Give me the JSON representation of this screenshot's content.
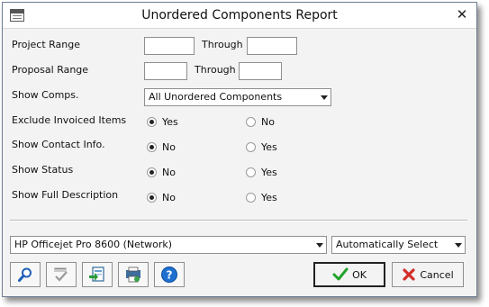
{
  "window": {
    "title": "Unordered Components Report",
    "close_glyph": "✕"
  },
  "form": {
    "project_range": {
      "label": "Project Range",
      "from": "",
      "through_label": "Through",
      "to": ""
    },
    "proposal_range": {
      "label": "Proposal Range",
      "from": "",
      "through_label": "Through",
      "to": ""
    },
    "show_comps": {
      "label": "Show Comps.",
      "selected": "All Unordered Components"
    },
    "exclude_invoiced": {
      "label": "Exclude Invoiced Items",
      "option1": "Yes",
      "option2": "No",
      "selected": "Yes"
    },
    "show_contact": {
      "label": "Show Contact Info.",
      "option1": "No",
      "option2": "Yes",
      "selected": "No"
    },
    "show_status": {
      "label": "Show Status",
      "option1": "No",
      "option2": "Yes",
      "selected": "No"
    },
    "show_full_description": {
      "label": "Show Full Description",
      "option1": "No",
      "option2": "Yes",
      "selected": "No"
    }
  },
  "printer": {
    "selected": "HP Officejet Pro 8600 (Network)",
    "tray": "Automatically Select"
  },
  "toolbar": {
    "icons": [
      "magnifier-icon",
      "spellcheck-icon",
      "export-icon",
      "print-setup-icon",
      "help-icon"
    ]
  },
  "buttons": {
    "ok_label": "OK",
    "cancel_label": "Cancel"
  },
  "colors": {
    "ok_check": "#22a32a",
    "cancel_x": "#d2302a",
    "help_blue": "#1f6fd1"
  }
}
